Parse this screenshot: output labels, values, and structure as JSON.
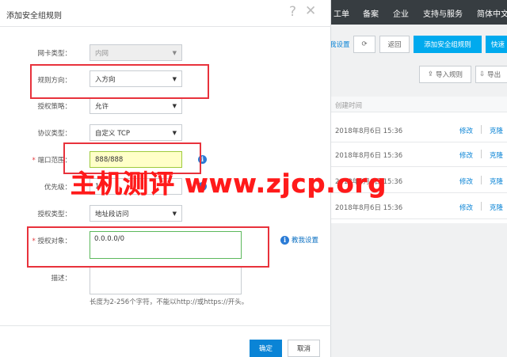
{
  "topnav": [
    "工单",
    "备案",
    "企业",
    "支持与服务",
    "简体中文"
  ],
  "toolbar": {
    "settings_partial": "我设置",
    "back": "返回",
    "add_rule": "添加安全组规则",
    "quick_partial": "快速",
    "import_rules": "导入规则",
    "export_partial": "导出"
  },
  "table": {
    "header_created": "创建时间",
    "rows": [
      {
        "created": "2018年8月6日 15:36",
        "edit": "修改",
        "clone": "克隆"
      },
      {
        "created": "2018年8月6日 15:36",
        "edit": "修改",
        "clone": "克隆"
      },
      {
        "created": "2018年8月6日 15:36",
        "edit": "修改",
        "clone": "克隆"
      },
      {
        "created": "2018年8月6日 15:36",
        "edit": "修改",
        "clone": "克隆"
      }
    ]
  },
  "dialog": {
    "title": "添加安全组规则",
    "help_glyph": "?",
    "close_glyph": "✕",
    "required_mark": "*",
    "nic_type": {
      "label": "网卡类型：",
      "value": "内网"
    },
    "direction": {
      "label": "规则方向：",
      "value": "入方向"
    },
    "policy": {
      "label": "授权策略：",
      "value": "允许"
    },
    "protocol": {
      "label": "协议类型：",
      "value": "自定义 TCP"
    },
    "port_range": {
      "label": "端口范围：",
      "value": "888/888"
    },
    "priority": {
      "label": "优先级：",
      "value": "1"
    },
    "auth_type": {
      "label": "授权类型：",
      "value": "地址段访问"
    },
    "auth_object": {
      "label": "授权对象：",
      "value": "0.0.0.0/0"
    },
    "teach_link": "教我设置",
    "description": {
      "label": "描述：",
      "value": ""
    },
    "description_hint": "长度为2-256个字符，不能以http://或https://开头。",
    "ok": "确定",
    "cancel": "取消"
  },
  "watermark": "主机测评 www.zjcp.org",
  "colors": {
    "accent": "#0a84d6",
    "highlight": "#e8323c",
    "nav_bg": "#373d41",
    "watermark": "#ff1a1a"
  }
}
